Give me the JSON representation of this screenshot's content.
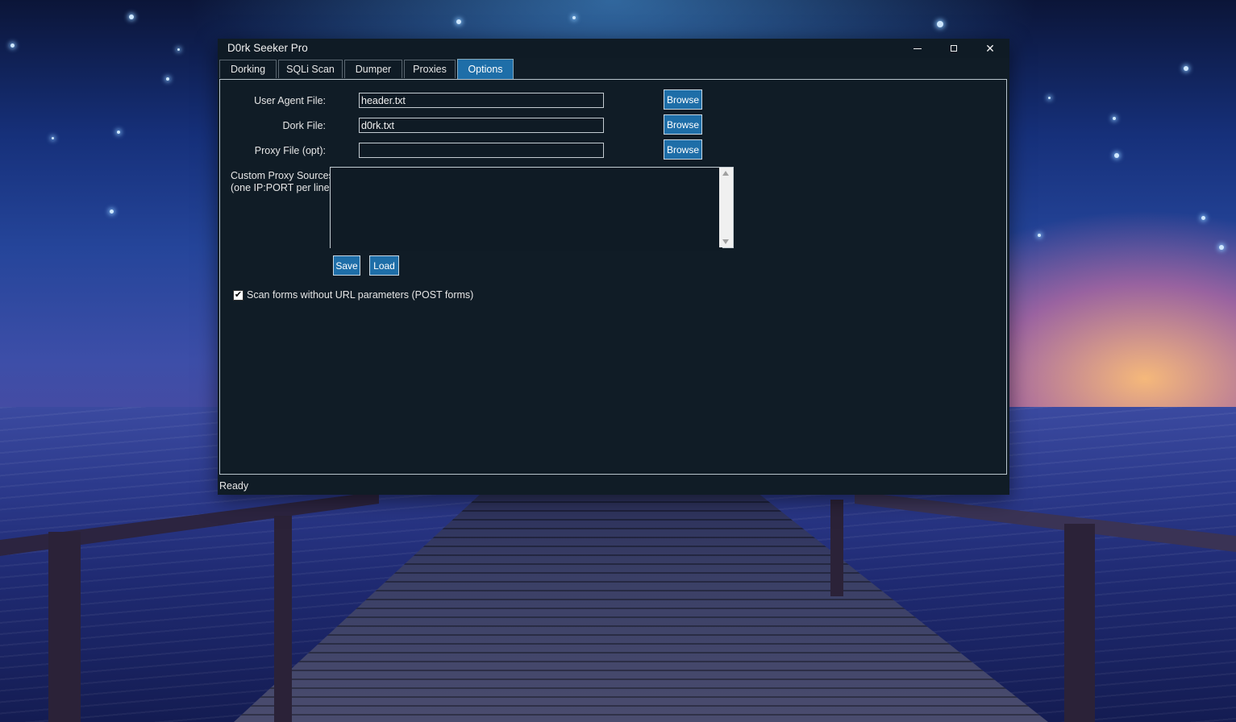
{
  "window": {
    "title": "D0rk Seeker Pro"
  },
  "tabs": [
    {
      "label": "Dorking"
    },
    {
      "label": "SQLi Scan"
    },
    {
      "label": "Dumper"
    },
    {
      "label": "Proxies"
    },
    {
      "label": "Options",
      "active": true
    }
  ],
  "options": {
    "user_agent": {
      "label": "User Agent File:",
      "value": "header.txt",
      "browse": "Browse"
    },
    "dork": {
      "label": "Dork File:",
      "value": "d0rk.txt",
      "browse": "Browse"
    },
    "proxy": {
      "label": "Proxy File (opt):",
      "value": "",
      "browse": "Browse"
    },
    "custom_proxy": {
      "label_line1": "Custom Proxy Sources",
      "label_line2": "(one IP:PORT per line):",
      "value": ""
    },
    "save_label": "Save",
    "load_label": "Load",
    "scan_forms": {
      "label": "Scan forms without URL parameters (POST forms)",
      "checked": true,
      "check_glyph": "✔"
    }
  },
  "status": {
    "text": "Ready"
  },
  "colors": {
    "accent": "#1e6ea8",
    "window_bg": "#101c26"
  }
}
